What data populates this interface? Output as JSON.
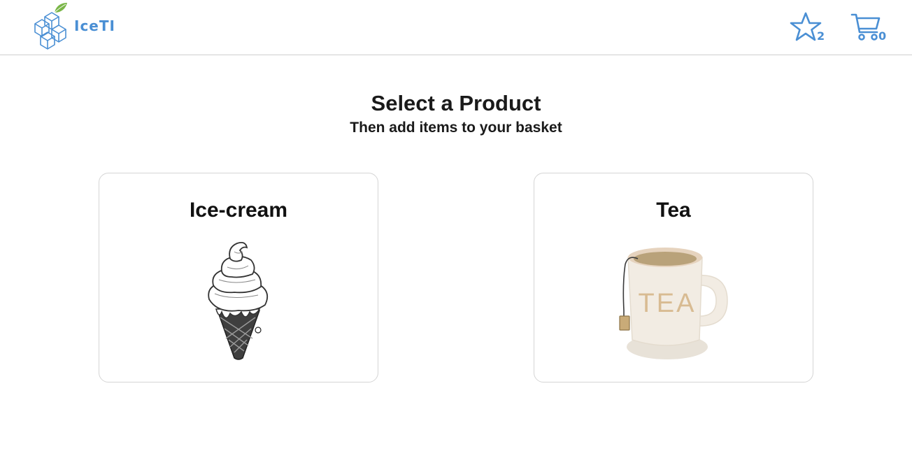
{
  "header": {
    "logo_text": "IceTI",
    "favorites_count": "2",
    "cart_count": "0"
  },
  "main": {
    "title": "Select a Product",
    "subtitle": "Then add items to your basket",
    "products": [
      {
        "name": "Ice-cream",
        "image": "ice-cream-cone-icon"
      },
      {
        "name": "Tea",
        "image": "tea-mug-icon",
        "mug_text": "TEA"
      }
    ]
  },
  "colors": {
    "accent": "#4a8fd4",
    "logo_leaf": "#7ab648",
    "card_border": "#d5d5d5",
    "tea_liquid": "#b9a27a",
    "tea_mug": "#f2ece3"
  }
}
